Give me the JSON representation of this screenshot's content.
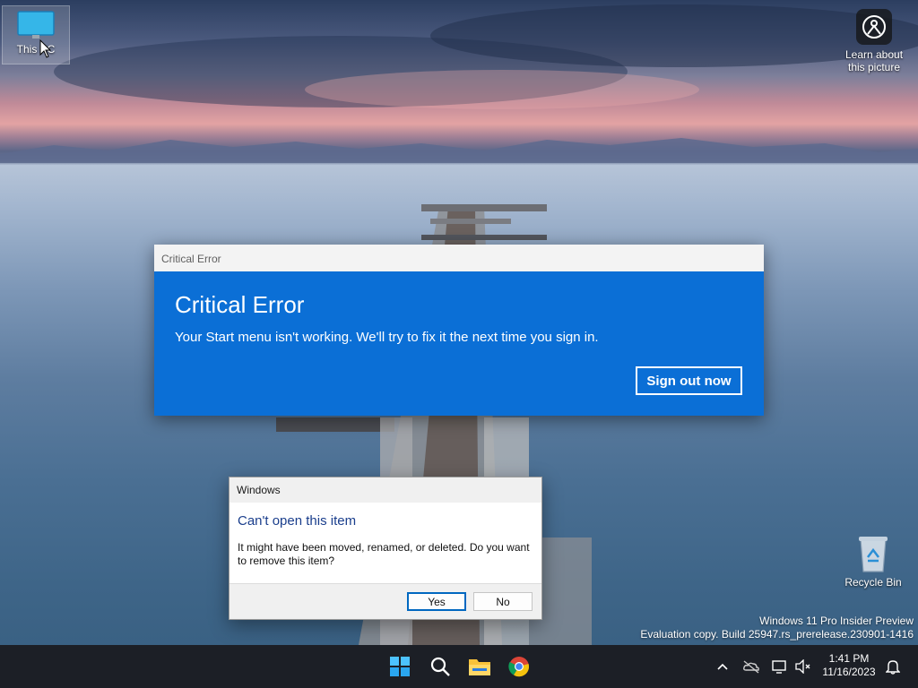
{
  "desktop": {
    "this_pc_label": "This PC",
    "recycle_bin_label": "Recycle Bin",
    "learn_label_line1": "Learn about",
    "learn_label_line2": "this picture"
  },
  "watermark": {
    "line1": "Windows 11 Pro Insider Preview",
    "line2": "Evaluation copy. Build 25947.rs_prerelease.230901-1416"
  },
  "critical_error": {
    "title": "Critical Error",
    "heading": "Critical Error",
    "message": "Your Start menu isn't working. We'll try to fix it the next time you sign in.",
    "button": "Sign out now",
    "accent": "#0b6fd6"
  },
  "windows_dialog": {
    "title": "Windows",
    "heading": "Can't open this item",
    "message": "It might have been moved, renamed, or deleted. Do you want to remove this item?",
    "yes_label": "Yes",
    "no_label": "No"
  },
  "taskbar": {
    "apps": [
      "windows-start-icon",
      "search-icon",
      "file-explorer-icon",
      "chrome-icon"
    ],
    "tray": [
      "chevron-up-icon",
      "onedrive-offline-icon",
      "network-icon",
      "volume-muted-icon",
      "notification-bell-icon"
    ],
    "time": "1:41 PM",
    "date": "11/16/2023"
  }
}
